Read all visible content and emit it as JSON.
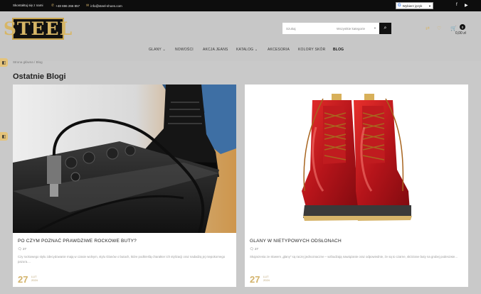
{
  "topbar": {
    "contact_label": "Skontaktuj się z nami",
    "phone": "+48 696 266 857",
    "email": "info@steel-shoes.com",
    "language_label": "Wybierz język"
  },
  "header": {
    "logo_text": "STEEL",
    "search_placeholder": "Szukaj",
    "search_category": "Wszystkie kategorie",
    "cart_count": "0",
    "cart_total": "0,00 zł"
  },
  "nav": {
    "items": [
      {
        "label": "GLANY"
      },
      {
        "label": "NOWOŚCI"
      },
      {
        "label": "AKCJA JEANS"
      },
      {
        "label": "KATALOG"
      },
      {
        "label": "AKCESORIA"
      },
      {
        "label": "KOLORY SKÓR"
      },
      {
        "label": "BLOG"
      }
    ]
  },
  "breadcrumb": {
    "home": "Strona główna",
    "current": "Blog"
  },
  "page": {
    "title": "Ostatnie Blogi"
  },
  "posts": [
    {
      "title": "PO CZYM POZNAĆ PRAWDZIWE ROCKOWE BUTY?",
      "comments": "27",
      "excerpt": "Czy rockowego stylu zdecydowanie mają w czasie wolnym, stylu Glanów o butach, które podkreślą charakter ich stylizacji oraz nadadzą jej niepokornego pazura....",
      "day": "27",
      "month": "LUT",
      "year": "2024"
    },
    {
      "title": "GLANY W NIETYPOWYCH ODSŁONACH",
      "comments": "27",
      "excerpt": "Skojarzenia ze słowem „glany\" są raczej jednoznaczne – wzbudzają nawiązanie oraz odpowiednie, że są to czarne, skórzane buty na grubej podeszwie...",
      "day": "27",
      "month": "LUT",
      "year": "2024"
    }
  ]
}
